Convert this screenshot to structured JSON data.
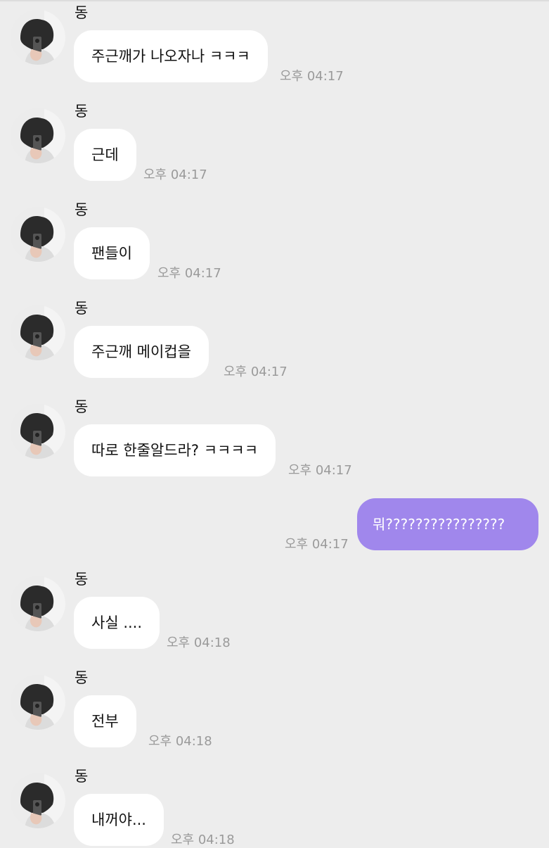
{
  "messages": [
    {
      "sender": "동",
      "text": "주근깨가 나오자나 ㅋㅋㅋ",
      "time": "오후 04:17"
    },
    {
      "sender": "동",
      "text": "근데",
      "time": "오후 04:17"
    },
    {
      "sender": "동",
      "text": "팬들이",
      "time": "오후 04:17"
    },
    {
      "sender": "동",
      "text": "주근깨 메이컵을",
      "time": "오후 04:17"
    },
    {
      "sender": "동",
      "text": "따로 한줄알드라? ㅋㅋㅋㅋ",
      "time": "오후 04:17"
    },
    {
      "sender": "동",
      "text": "사실 ....",
      "time": "오후 04:18"
    },
    {
      "sender": "동",
      "text": "전부",
      "time": "오후 04:18"
    },
    {
      "sender": "동",
      "text": "내꺼야...",
      "time": "오후 04:18"
    }
  ],
  "outgoing": {
    "text": "뭐????????????????",
    "time": "오후 04:17"
  },
  "colors": {
    "background": "#ededed",
    "incoming_bubble": "#ffffff",
    "outgoing_bubble": "#a087ec",
    "timestamp": "#9a9a9a"
  },
  "icons": {
    "avatar": "profile-photo-avatar"
  }
}
